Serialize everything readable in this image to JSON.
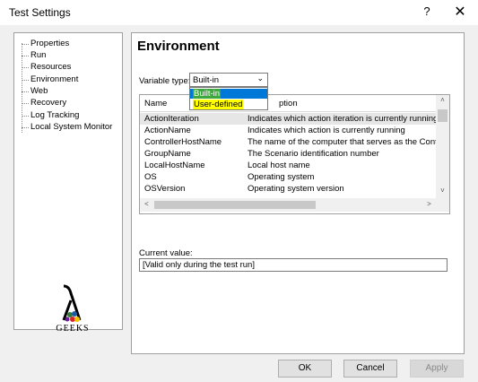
{
  "window": {
    "title": "Test Settings",
    "help_glyph": "?",
    "close_glyph": "✕"
  },
  "nav": {
    "items": [
      {
        "label": "Properties"
      },
      {
        "label": "Run"
      },
      {
        "label": "Resources"
      },
      {
        "label": "Environment"
      },
      {
        "label": "Web"
      },
      {
        "label": "Recovery"
      },
      {
        "label": "Log Tracking"
      },
      {
        "label": "Local System Monitor"
      }
    ]
  },
  "logo": {
    "text": "GEEKS"
  },
  "main": {
    "title": "Environment",
    "variable_type": {
      "label": "Variable type:",
      "value": "Built-in",
      "options": [
        "Built-in",
        "User-defined"
      ]
    },
    "grid": {
      "columns": [
        "Name",
        "ption"
      ],
      "rows": [
        {
          "name": "ActionIteration",
          "desc": "Indicates which action iteration is currently running"
        },
        {
          "name": "ActionName",
          "desc": "Indicates which action is currently running"
        },
        {
          "name": "ControllerHostName",
          "desc": "The name of the computer that serves as the Control"
        },
        {
          "name": "GroupName",
          "desc": "The Scenario identification number"
        },
        {
          "name": "LocalHostName",
          "desc": "Local host name"
        },
        {
          "name": "OS",
          "desc": "Operating system"
        },
        {
          "name": "OSVersion",
          "desc": "Operating system version"
        }
      ]
    },
    "current_value": {
      "label": "Current value:",
      "value": "[Valid only during the test run]"
    }
  },
  "buttons": {
    "ok": "OK",
    "cancel": "Cancel",
    "apply": "Apply"
  },
  "colors": {
    "dropdown_highlight": "#0078d7",
    "builtin_mark": "#3ea83e",
    "userdefined_mark": "#ffff00"
  }
}
